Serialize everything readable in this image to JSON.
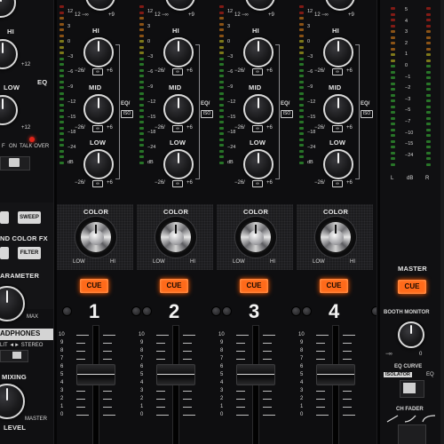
{
  "left_panel": {
    "eq_labels": {
      "hi": "HI",
      "low": "LOW",
      "eq": "EQ"
    },
    "scale_plus12": "+12",
    "talkover_labels": [
      "F",
      "ON",
      "TALK OVER"
    ],
    "sweep_label": "SWEEP",
    "filter_label": "FILTER",
    "sound_color_fx": "ND COLOR FX",
    "parameter": "ARAMETER",
    "max": "MAX",
    "headphones": "ADPHONES",
    "split_stereo": "LIT ◄► STEREO",
    "mixing": "MIXING",
    "master": "MASTER",
    "level": "LEVEL"
  },
  "channels": [
    {
      "number": "1",
      "cue": "CUE",
      "color": "COLOR",
      "low": "LOW",
      "hi": "HI",
      "eq_iso": [
        "EQ/",
        "ISO"
      ],
      "labels": {
        "hi": "HI",
        "mid": "MID",
        "low": "LOW"
      },
      "scale": {
        "minus": "−26/",
        "iso_mark": "∞",
        "plus": "+6",
        "minus_inf": "−∞",
        "plus9": "+9",
        "twelve": "12"
      }
    },
    {
      "number": "2",
      "cue": "CUE",
      "color": "COLOR",
      "low": "LOW",
      "hi": "HI",
      "eq_iso": [
        "EQ/",
        "ISO"
      ],
      "labels": {
        "hi": "HI",
        "mid": "MID",
        "low": "LOW"
      },
      "scale": {
        "minus": "−26/",
        "iso_mark": "∞",
        "plus": "+6",
        "minus_inf": "−∞",
        "plus9": "+9",
        "twelve": "12"
      }
    },
    {
      "number": "3",
      "cue": "CUE",
      "color": "COLOR",
      "low": "LOW",
      "hi": "HI",
      "eq_iso": [
        "EQ/",
        "ISO"
      ],
      "labels": {
        "hi": "HI",
        "mid": "MID",
        "low": "LOW"
      },
      "scale": {
        "minus": "−26/",
        "iso_mark": "∞",
        "plus": "+6",
        "minus_inf": "−∞",
        "plus9": "+9",
        "twelve": "12"
      }
    },
    {
      "number": "4",
      "cue": "CUE",
      "color": "COLOR",
      "low": "LOW",
      "hi": "HI",
      "eq_iso": [
        "EQ/",
        "ISO"
      ],
      "labels": {
        "hi": "HI",
        "mid": "MID",
        "low": "LOW"
      },
      "scale": {
        "minus": "−26/",
        "iso_mark": "∞",
        "plus": "+6",
        "minus_inf": "−∞",
        "plus9": "+9",
        "twelve": "12"
      }
    }
  ],
  "meter_scale": [
    "12",
    "3",
    "0",
    "−3",
    "−6",
    "−9",
    "−12",
    "−15",
    "−18",
    "−24",
    "dB"
  ],
  "fader_scale": [
    "10",
    "9",
    "8",
    "7",
    "6",
    "5",
    "4",
    "3",
    "2",
    "1",
    "0"
  ],
  "master_section": {
    "meter_labels": [
      "5",
      "4",
      "3",
      "2",
      "1",
      "0",
      "−1",
      "−2",
      "−3",
      "−5",
      "−7",
      "−10",
      "−15",
      "−24"
    ],
    "meter_foot": [
      "L",
      "dB",
      "R"
    ],
    "master": "MASTER",
    "cue": "CUE",
    "booth_monitor": "BOOTH MONITOR",
    "minus_inf": "−∞",
    "booth_zero": "0",
    "eq_curve": "EQ CURVE",
    "isolator": "ISOLATOR",
    "eq": "EQ",
    "ch_fader": "CH FADER"
  },
  "colors": {
    "cue_orange": "#ff6a1a",
    "meter_red": "#e0241a",
    "meter_orange": "#f08a1a",
    "meter_yellow": "#d8d020",
    "meter_green": "#3cc83a"
  }
}
